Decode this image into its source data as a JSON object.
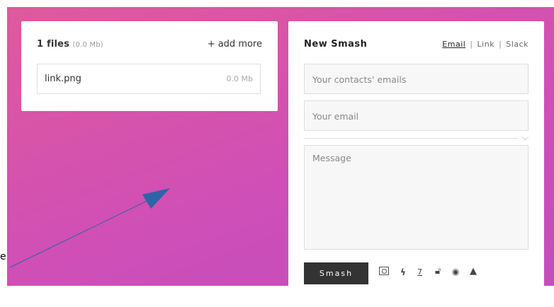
{
  "upload": {
    "files_count": "1 files",
    "files_total": "(0.0 Mb)",
    "add_more": "+ add more",
    "files": [
      {
        "name": "link.png",
        "size": "0.0 Mb"
      }
    ]
  },
  "smash": {
    "title": "New Smash",
    "tabs": [
      "Email",
      "Link",
      "Slack"
    ],
    "active_tab": "Email",
    "contacts_placeholder": "Your contacts' emails",
    "email_placeholder": "Your email",
    "message_placeholder": "Message",
    "smash_label": "Smash",
    "option_icons": [
      "photo-icon",
      "bolt-icon",
      "expiry-days",
      "lock-icon",
      "eye-icon",
      "bell-icon"
    ],
    "expiry_days": "7"
  },
  "annotation": {
    "edge_letter": "e"
  },
  "colors": {
    "gradient_start": "#e05a9a",
    "gradient_end": "#c04dbf",
    "button_bg": "#333333",
    "arrow": "#2e63a8"
  }
}
